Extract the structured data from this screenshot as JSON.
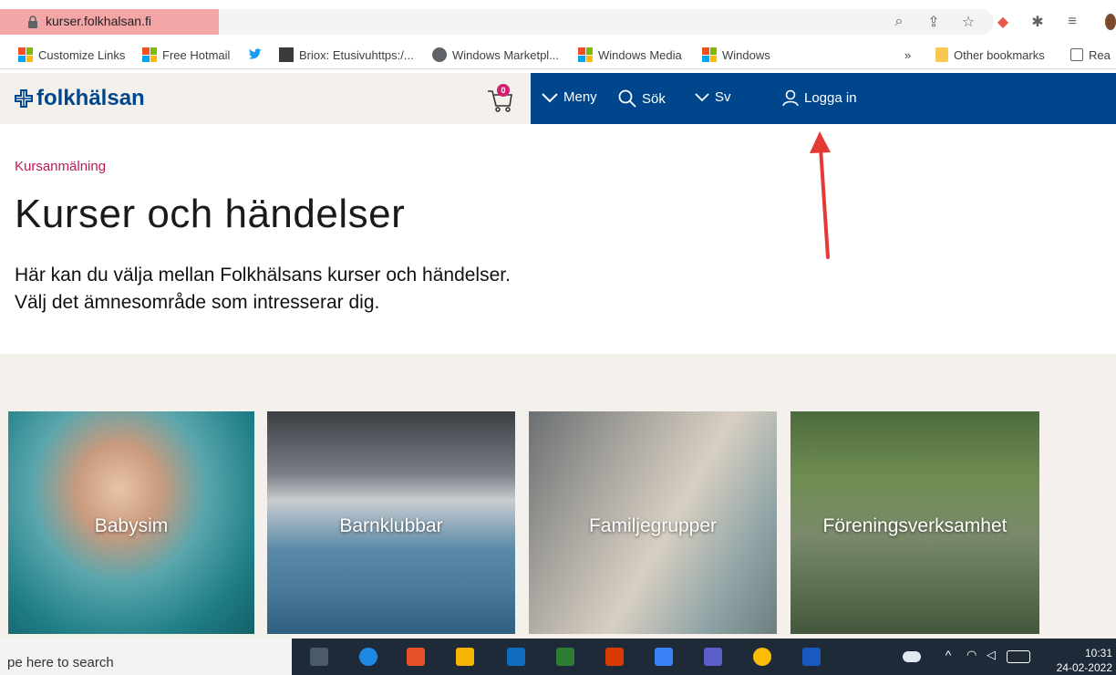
{
  "browser": {
    "url": "kurser.folkhalsan.fi",
    "bookmarks": [
      {
        "label": "Customize Links"
      },
      {
        "label": "Free Hotmail"
      },
      {
        "label": "Briox: Etusivuhttps:/..."
      },
      {
        "label": "Windows Marketpl..."
      },
      {
        "label": "Windows Media"
      },
      {
        "label": "Windows"
      }
    ],
    "overflow": "»",
    "other_bookmarks": "Other bookmarks",
    "reading_list": "Rea"
  },
  "site": {
    "logo": "folkhälsan",
    "cart_count": "0",
    "nav": {
      "menu": "Meny",
      "search": "Sök",
      "language": "Sv",
      "login": "Logga in"
    }
  },
  "page": {
    "breadcrumb": "Kursanmälning",
    "title": "Kurser och händelser",
    "intro_line1": "Här kan du välja mellan Folkhälsans kurser och händelser.",
    "intro_line2": "Välj det ämnesområde som intresserar dig.",
    "categories": [
      {
        "label": "Babysim"
      },
      {
        "label": "Barnklubbar"
      },
      {
        "label": "Familjegrupper"
      },
      {
        "label": "Föreningsverksamhet"
      }
    ]
  },
  "taskbar": {
    "search_text": "pe here to search",
    "time": "10:31",
    "date": "24-02-2022"
  },
  "colors": {
    "brand_blue": "#00468c",
    "accent_pink": "#c2185b",
    "annotation_red": "#e53935"
  }
}
